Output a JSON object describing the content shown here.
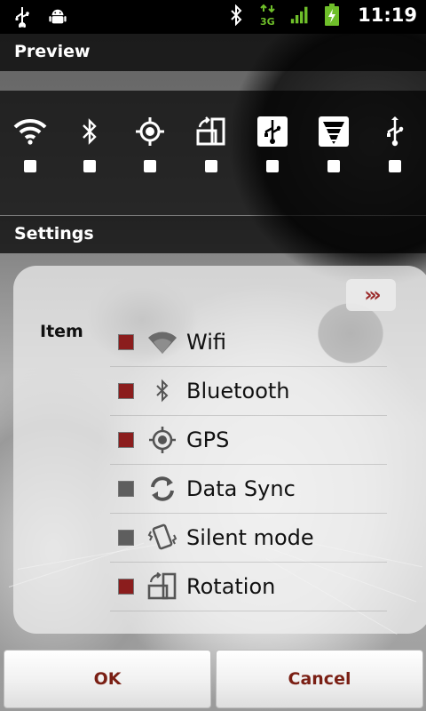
{
  "status_bar": {
    "left_icons": [
      "usb-icon",
      "android-debug-icon"
    ],
    "right_icons": [
      "bluetooth-icon",
      "3g-data-icon",
      "signal-icon",
      "battery-charging-icon"
    ],
    "time": "11:19"
  },
  "preview": {
    "title": "Preview",
    "items": [
      {
        "icon": "wifi-icon"
      },
      {
        "icon": "bluetooth-icon"
      },
      {
        "icon": "gps-icon"
      },
      {
        "icon": "rotation-icon"
      },
      {
        "icon": "usb-box-icon"
      },
      {
        "icon": "brightness-icon"
      },
      {
        "icon": "usb-icon"
      }
    ]
  },
  "settings": {
    "title": "Settings",
    "item_header": "Item",
    "more_label": "›››",
    "items": [
      {
        "label": "Wifi",
        "icon": "wifi-icon",
        "checked": true
      },
      {
        "label": "Bluetooth",
        "icon": "bluetooth-icon",
        "checked": true
      },
      {
        "label": "GPS",
        "icon": "gps-icon",
        "checked": true
      },
      {
        "label": "Data Sync",
        "icon": "sync-icon",
        "checked": false
      },
      {
        "label": "Silent mode",
        "icon": "vibrate-icon",
        "checked": false
      },
      {
        "label": "Rotation",
        "icon": "rotation-icon",
        "checked": true
      }
    ]
  },
  "buttons": {
    "ok": "OK",
    "cancel": "Cancel"
  },
  "colors": {
    "checked": "#8b1d1d",
    "unchecked": "#5e5e5e",
    "button_text": "#7a1f14",
    "accent_green": "#6fbf2a"
  }
}
